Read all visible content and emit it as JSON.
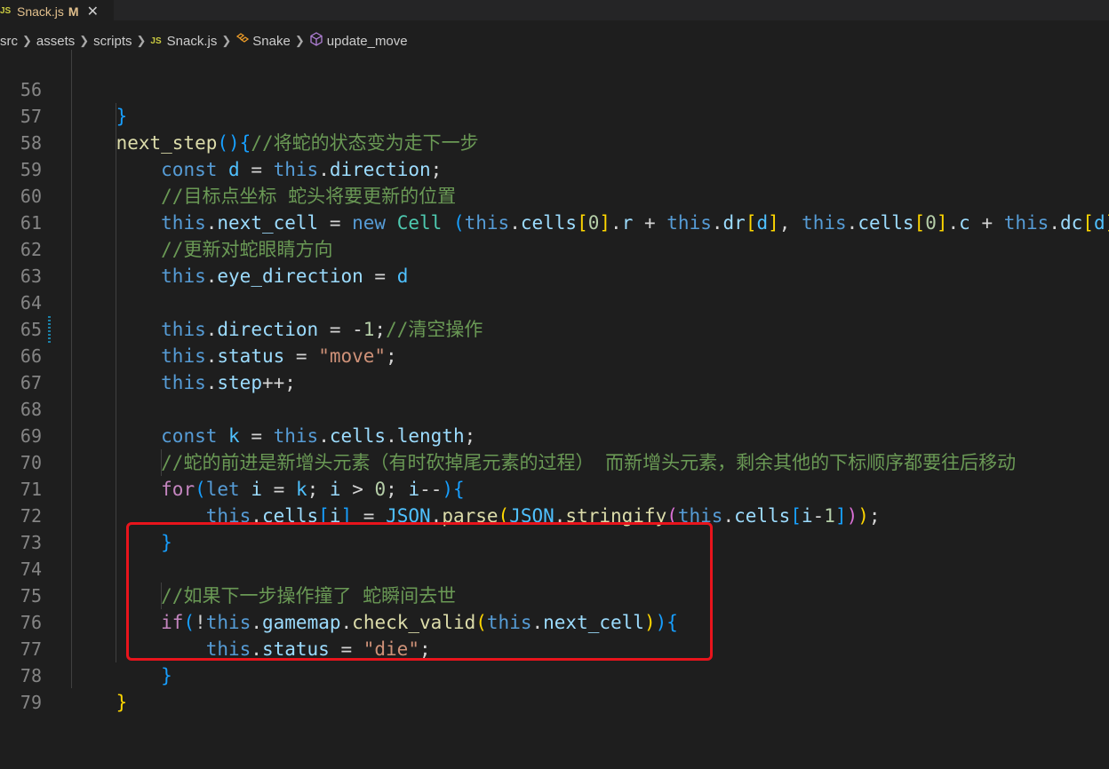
{
  "tab": {
    "badge": "JS",
    "filename": "Snack.js",
    "modified": "M",
    "close": "✕"
  },
  "breadcrumb": {
    "src": "src",
    "assets": "assets",
    "scripts": "scripts",
    "file_badge": "JS",
    "file": "Snack.js",
    "class": "Snake",
    "method": "update_move"
  },
  "lines": [
    {
      "n": "56"
    },
    {
      "n": "57"
    },
    {
      "n": "58"
    },
    {
      "n": "59"
    },
    {
      "n": "60"
    },
    {
      "n": "61"
    },
    {
      "n": "62"
    },
    {
      "n": "63"
    },
    {
      "n": "64"
    },
    {
      "n": "65"
    },
    {
      "n": "66"
    },
    {
      "n": "67"
    },
    {
      "n": "68"
    },
    {
      "n": "69"
    },
    {
      "n": "70"
    },
    {
      "n": "71"
    },
    {
      "n": "72"
    },
    {
      "n": "73"
    },
    {
      "n": "74"
    },
    {
      "n": "75"
    },
    {
      "n": "76"
    },
    {
      "n": "77"
    },
    {
      "n": "78"
    },
    {
      "n": "79"
    }
  ],
  "code": {
    "l57_comment": "//将蛇的状态变为走下一步",
    "l59_comment": "//目标点坐标 蛇头将要更新的位置",
    "l61_comment": "//更新对蛇眼睛方向",
    "l64_comment": "//清空操作",
    "l65_str": "\"move\"",
    "l69_comment": "//蛇的前进是新增头元素（有时砍掉尾元素的过程） 而新增头元素，剩余其他的下标顺序都要往后移动",
    "l74_comment": "//如果下一步操作撞了 蛇瞬间去世",
    "l76_str": "\"die\""
  },
  "colors": {
    "highlight_box": "#e8141c",
    "modified_tab": "#e2c08d"
  }
}
